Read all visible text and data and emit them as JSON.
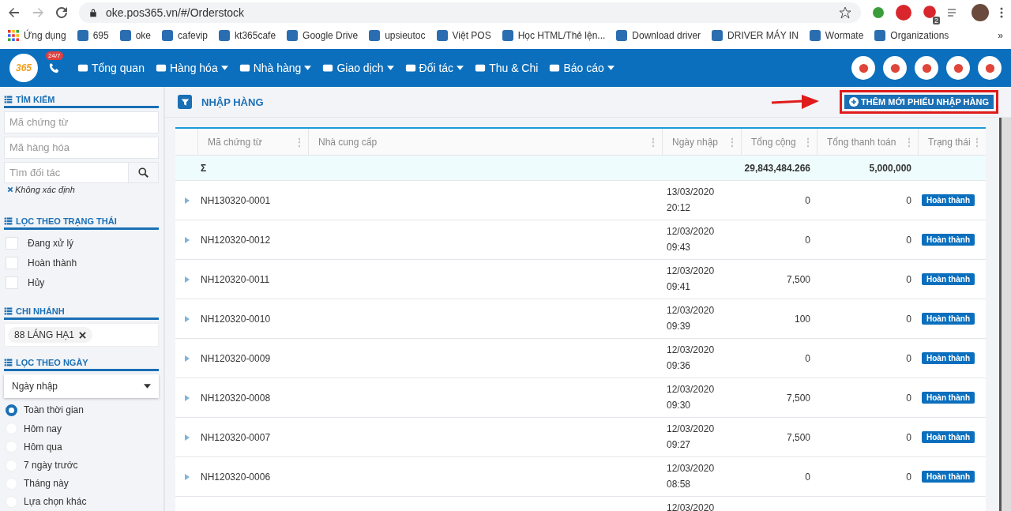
{
  "browser": {
    "url": "oke.pos365.vn/#/Orderstock",
    "bookmarks": [
      "Ứng dụng",
      "695",
      "oke",
      "cafevip",
      "kt365cafe",
      "Google Drive",
      "upsieutoc",
      "Việt POS",
      "Học HTML/Thẻ lện...",
      "Download driver",
      "DRIVER MÁY IN",
      "Wormate",
      "Organizations"
    ],
    "extension_badge": "2",
    "more": "»"
  },
  "navbar": {
    "logo": "365",
    "hotline_badge": "24/7",
    "menu": [
      {
        "label": "Tổng quan",
        "dropdown": false
      },
      {
        "label": "Hàng hóa",
        "dropdown": true
      },
      {
        "label": "Nhà hàng",
        "dropdown": true
      },
      {
        "label": "Giao dịch",
        "dropdown": true
      },
      {
        "label": "Đối tác",
        "dropdown": true
      },
      {
        "label": "Thu & Chi",
        "dropdown": false
      },
      {
        "label": "Báo cáo",
        "dropdown": true
      }
    ]
  },
  "sidebar": {
    "search_title": "TÌM KIẾM",
    "fields": [
      {
        "placeholder": "Mã chứng từ"
      },
      {
        "placeholder": "Mã hàng hóa"
      }
    ],
    "partner_field": {
      "placeholder": "Tìm đối tác"
    },
    "partner_note": "Không xác định",
    "status_title": "LỌC THEO TRẠNG THÁI",
    "statuses": [
      {
        "label": "Đang xử lý",
        "checked": false
      },
      {
        "label": "Hoàn thành",
        "checked": false
      },
      {
        "label": "Hủy",
        "checked": false
      }
    ],
    "branch_title": "CHI NHÁNH",
    "branch_tag": "88 LÁNG HẠ1",
    "date_title": "LỌC THEO NGÀY",
    "date_select": "Ngày nhập",
    "date_options": [
      {
        "label": "Toàn thời gian",
        "selected": true
      },
      {
        "label": "Hôm nay",
        "selected": false
      },
      {
        "label": "Hôm qua",
        "selected": false
      },
      {
        "label": "7 ngày trước",
        "selected": false
      },
      {
        "label": "Tháng này",
        "selected": false
      },
      {
        "label": "Lựa chọn khác",
        "selected": false
      }
    ]
  },
  "page": {
    "title": "NHẬP HÀNG",
    "add_button": "THÊM MỚI PHIẾU NHẬP HÀNG"
  },
  "table": {
    "columns": [
      {
        "label": "Mã chứng từ",
        "menu": "⋮"
      },
      {
        "label": "Nhà cung cấp",
        "menu": "⋮"
      },
      {
        "label": "Ngày nhập",
        "menu": "⋮"
      },
      {
        "label": "Tổng cộng",
        "menu": "⋮"
      },
      {
        "label": "Tổng thanh toán",
        "menu": "⋮"
      },
      {
        "label": "Trạng thái",
        "menu": "⋮"
      }
    ],
    "sum": {
      "symbol": "Σ",
      "total": "29,843,484.266",
      "paid": "5,000,000"
    },
    "rows": [
      {
        "code": "NH130320-0001",
        "date": "13/03/2020",
        "time": "20:12",
        "total": "0",
        "paid": "0",
        "status": "Hoàn thành"
      },
      {
        "code": "NH120320-0012",
        "date": "12/03/2020",
        "time": "09:43",
        "total": "0",
        "paid": "0",
        "status": "Hoàn thành"
      },
      {
        "code": "NH120320-0011",
        "date": "12/03/2020",
        "time": "09:41",
        "total": "7,500",
        "paid": "0",
        "status": "Hoàn thành"
      },
      {
        "code": "NH120320-0010",
        "date": "12/03/2020",
        "time": "09:39",
        "total": "100",
        "paid": "0",
        "status": "Hoàn thành"
      },
      {
        "code": "NH120320-0009",
        "date": "12/03/2020",
        "time": "09:36",
        "total": "0",
        "paid": "0",
        "status": "Hoàn thành"
      },
      {
        "code": "NH120320-0008",
        "date": "12/03/2020",
        "time": "09:30",
        "total": "7,500",
        "paid": "0",
        "status": "Hoàn thành"
      },
      {
        "code": "NH120320-0007",
        "date": "12/03/2020",
        "time": "09:27",
        "total": "7,500",
        "paid": "0",
        "status": "Hoàn thành"
      },
      {
        "code": "NH120320-0006",
        "date": "12/03/2020",
        "time": "08:58",
        "total": "0",
        "paid": "0",
        "status": "Hoàn thành"
      },
      {
        "date": "12/03/2020"
      }
    ]
  }
}
